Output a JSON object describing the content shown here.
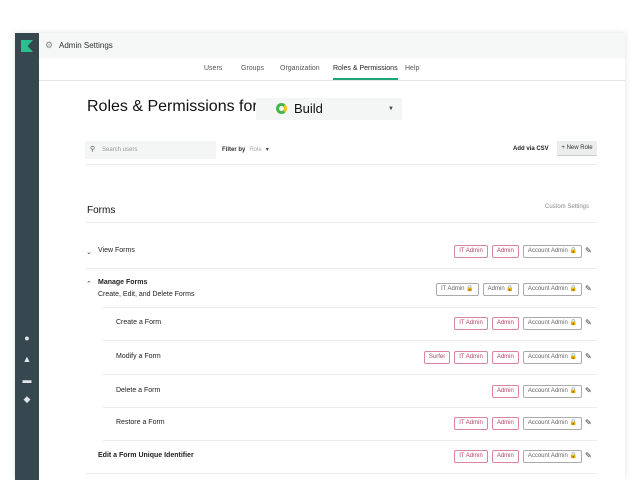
{
  "header": {
    "title": "Admin Settings"
  },
  "tabs": [
    "Users",
    "Groups",
    "Organization",
    "Roles & Permissions",
    "Help"
  ],
  "page": {
    "title": "Roles & Permissions for",
    "project": "Build"
  },
  "toolbar": {
    "search_placeholder": "Search users",
    "filter_label": "Filter by",
    "filter_value": "Role",
    "add_csv": "Add via CSV",
    "new_role": "+ New Role"
  },
  "section": {
    "title": "Forms",
    "custom": "Custom Settings"
  },
  "colors": {
    "sidebar": "#37474f",
    "accent": "#1ea67a",
    "chip": "#b8426d"
  },
  "rows": [
    {
      "label": "View Forms",
      "chips": [
        {
          "t": "IT Admin"
        },
        {
          "t": "Admin"
        },
        {
          "t": "Account Admin 🔒",
          "g": 1
        }
      ]
    },
    {
      "label": "Manage Forms",
      "sub": "Create, Edit, and Delete Forms",
      "chips": [
        {
          "t": "IT Admin 🔒",
          "g": 1
        },
        {
          "t": "Admin 🔒",
          "g": 1
        },
        {
          "t": "Account Admin 🔒",
          "g": 1
        }
      ]
    },
    {
      "label": "Create a Form",
      "chips": [
        {
          "t": "IT Admin"
        },
        {
          "t": "Admin"
        },
        {
          "t": "Account Admin 🔒",
          "g": 1
        }
      ]
    },
    {
      "label": "Modify a Form",
      "chips": [
        {
          "t": "Surfer"
        },
        {
          "t": "IT Admin"
        },
        {
          "t": "Admin"
        },
        {
          "t": "Account Admin 🔒",
          "g": 1
        }
      ]
    },
    {
      "label": "Delete a Form",
      "chips": [
        {
          "t": "Admin"
        },
        {
          "t": "Account Admin 🔒",
          "g": 1
        }
      ]
    },
    {
      "label": "Restore a Form",
      "chips": [
        {
          "t": "IT Admin"
        },
        {
          "t": "Admin"
        },
        {
          "t": "Account Admin 🔒",
          "g": 1
        }
      ]
    },
    {
      "label": "Edit  a Form Unique Identifier",
      "chips": [
        {
          "t": "IT Admin"
        },
        {
          "t": "Admin"
        },
        {
          "t": "Account Admin 🔒",
          "g": 1
        }
      ]
    }
  ]
}
